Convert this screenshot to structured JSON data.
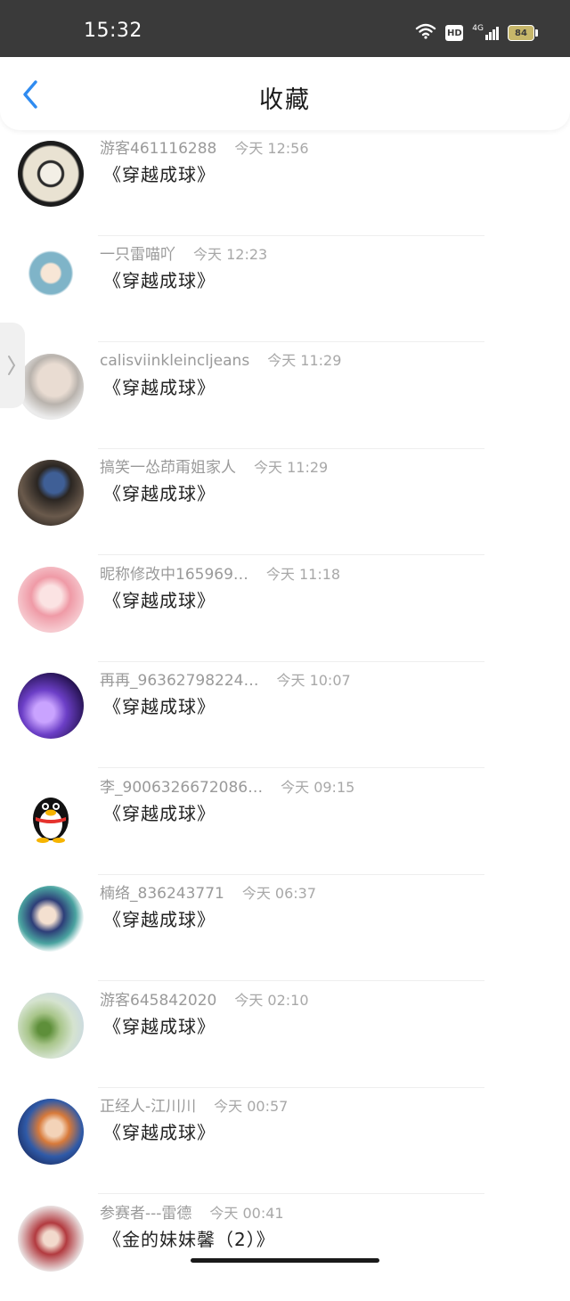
{
  "status_bar": {
    "time": "15:32",
    "hd": "HD",
    "network": "4G",
    "battery": "84"
  },
  "header": {
    "title": "收藏",
    "back_icon": "chevron-left-icon"
  },
  "colors": {
    "accent": "#2f8bf0",
    "status_bar_bg": "#3a3a3a",
    "battery": "#c7b76a"
  },
  "favorites": [
    {
      "name": "游客461116288",
      "time": "今天 12:56",
      "content": "《穿越成球》"
    },
    {
      "name": "一只雷喵吖",
      "time": "今天 12:23",
      "content": "《穿越成球》"
    },
    {
      "name": "calisviinkleincljeans",
      "time": "今天 11:29",
      "content": "《穿越成球》"
    },
    {
      "name": "搞笑一怂茚甭姐家人",
      "time": "今天 11:29",
      "content": "《穿越成球》"
    },
    {
      "name": "昵称修改中165969…",
      "time": "今天 11:18",
      "content": "《穿越成球》"
    },
    {
      "name": "再再_96362798224…",
      "time": "今天 10:07",
      "content": "《穿越成球》"
    },
    {
      "name": "李_9006326672086…",
      "time": "今天 09:15",
      "content": "《穿越成球》"
    },
    {
      "name": "楠络_836243771",
      "time": "今天 06:37",
      "content": "《穿越成球》"
    },
    {
      "name": "游客645842020",
      "time": "今天 02:10",
      "content": "《穿越成球》"
    },
    {
      "name": "正经人-江川川",
      "time": "今天 00:57",
      "content": "《穿越成球》"
    },
    {
      "name": "参赛者---雷德",
      "time": "今天 00:41",
      "content": "《金的妹妹馨（2）》"
    }
  ]
}
